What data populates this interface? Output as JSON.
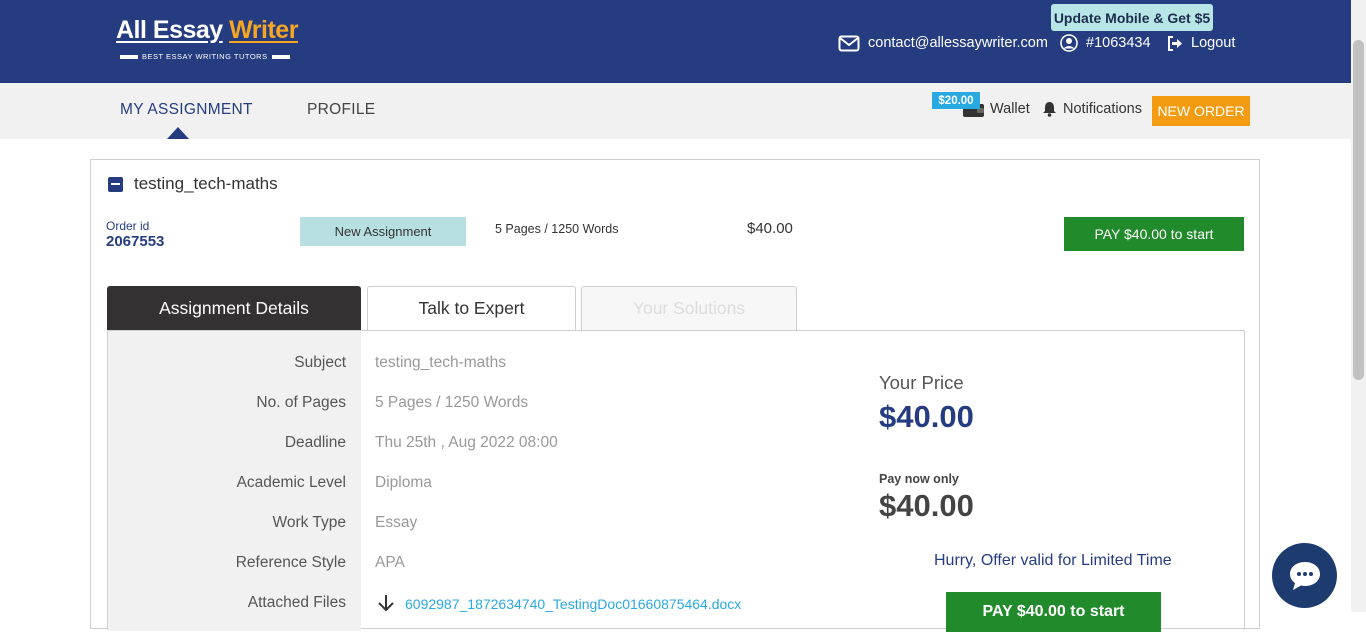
{
  "brand": {
    "name_part1": "All Essay",
    "name_part2": "Writer",
    "tagline": "BEST ESSAY WRITING TUTORS",
    "accent": "#f5a623",
    "primary": "#253d80"
  },
  "header": {
    "promo_badge": "Update Mobile & Get $5",
    "contact_email": "contact@allessaywriter.com",
    "user_id": "#1063434",
    "logout_label": "Logout",
    "icons": {
      "email": "envelope-icon",
      "user": "user-circle-icon",
      "logout": "sign-out-icon"
    }
  },
  "subnav": {
    "tabs": [
      {
        "label": "MY ASSIGNMENT",
        "active": true
      },
      {
        "label": "PROFILE",
        "active": false
      }
    ],
    "wallet_amount": "$20.00",
    "wallet_label": "Wallet",
    "notifications_label": "Notifications",
    "new_order_label": "NEW ORDER"
  },
  "order": {
    "title": "testing_tech-maths",
    "order_id_label": "Order id",
    "order_id": "2067553",
    "status": "New Assignment",
    "pages_summary": "5 Pages / 1250 Words",
    "price": "$40.00",
    "pay_button": "PAY $40.00 to start"
  },
  "tabs": [
    {
      "label": "Assignment Details",
      "active": true
    },
    {
      "label": "Talk to Expert",
      "active": false
    },
    {
      "label": "Your Solutions",
      "disabled": true
    }
  ],
  "details": [
    {
      "label": "Subject",
      "value": "testing_tech-maths"
    },
    {
      "label": "No. of Pages",
      "value": "5 Pages / 1250 Words"
    },
    {
      "label": "Deadline",
      "value": "Thu 25th , Aug 2022 08:00"
    },
    {
      "label": "Academic Level",
      "value": "Diploma"
    },
    {
      "label": "Work Type",
      "value": "Essay"
    },
    {
      "label": "Reference Style",
      "value": "APA"
    },
    {
      "label": "Attached Files",
      "value": "6092987_1872634740_TestingDoc01660875464.docx"
    }
  ],
  "pricing": {
    "your_price_label": "Your Price",
    "your_price": "$40.00",
    "pay_now_label": "Pay now only",
    "pay_now_price": "$40.00",
    "offer_text": "Hurry, Offer valid for Limited Time",
    "pay_button": "PAY $40.00 to start"
  },
  "chat": {
    "icon": "chat-bubble-icon"
  }
}
